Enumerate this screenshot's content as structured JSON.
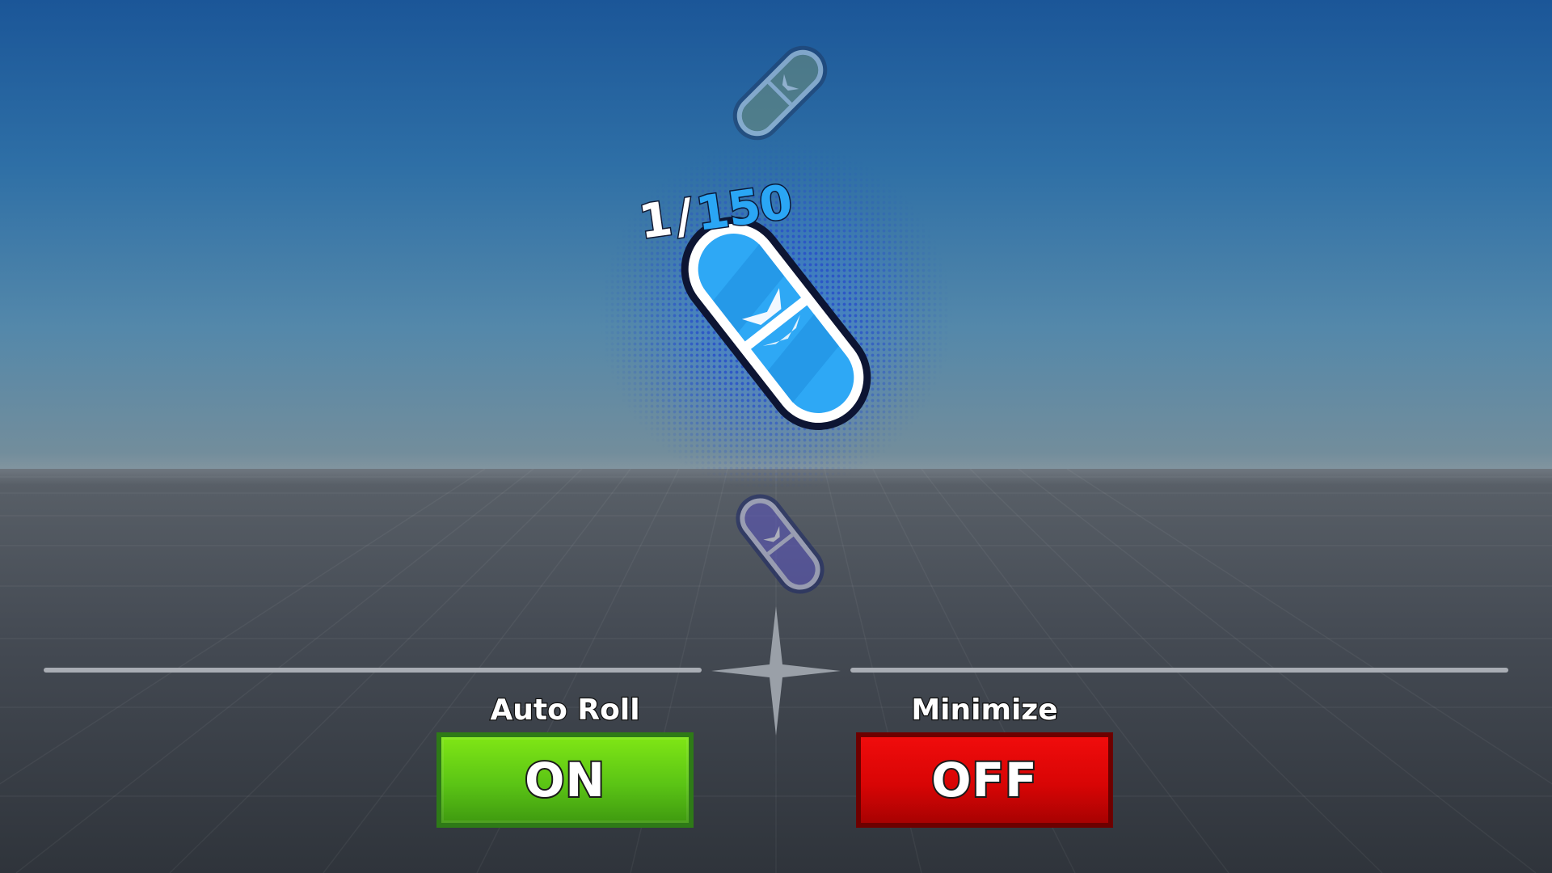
{
  "roll": {
    "current": "1",
    "separator": "/",
    "total": "150"
  },
  "controls": {
    "auto_roll": {
      "label": "Auto Roll",
      "state": "ON"
    },
    "minimize": {
      "label": "Minimize",
      "state": "OFF"
    }
  },
  "colors": {
    "on": "#5bc415",
    "off": "#d80505",
    "pill_main": "#2ea8f5",
    "pill_prev": "#6f8f9a",
    "pill_next": "#5a55b8",
    "counter_total": "#2aa6f5"
  },
  "items": {
    "previous": {
      "icon": "capsule-icon",
      "tint": "gray-green"
    },
    "current": {
      "icon": "capsule-icon",
      "tint": "blue"
    },
    "next": {
      "icon": "capsule-icon",
      "tint": "purple"
    }
  }
}
